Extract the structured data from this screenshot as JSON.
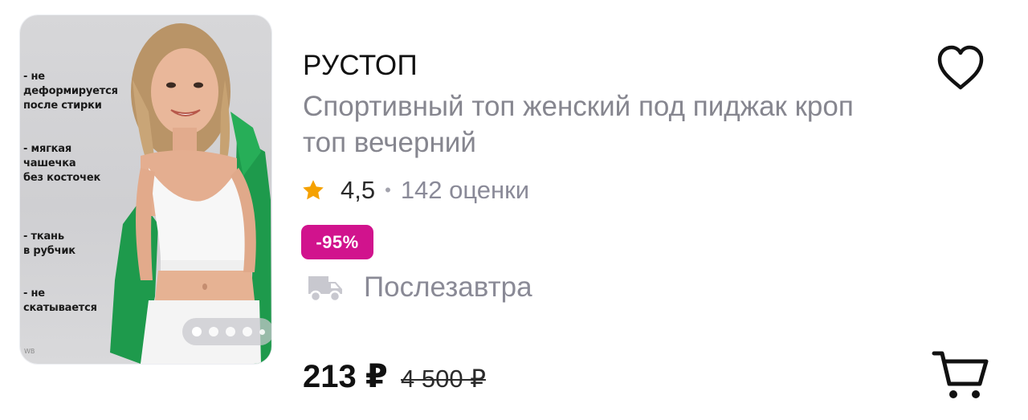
{
  "product": {
    "brand": "РУСТОП",
    "title": "Спортивный топ женский под пиджак кроп топ вечерний",
    "rating": "4,5",
    "separator": "•",
    "reviews": "142 оценки",
    "discount": "-95%",
    "delivery": "Послезавтра",
    "price": "213 ₽",
    "old_price": "4 500 ₽"
  },
  "image": {
    "features": [
      "- не\nдеформируется\nпосле стирки",
      "- мягкая\nчашечка\nбез косточек",
      "- ткань\nв рубчик",
      "- не\nскатывается"
    ],
    "watermark": "WB",
    "carousel_dots": 5,
    "carousel_active": 1
  },
  "icons": {
    "favorite": "heart-outline-icon",
    "cart": "shopping-cart-icon",
    "delivery": "truck-icon",
    "rating": "star-icon"
  },
  "colors": {
    "discount_badge": "#d1138d",
    "star": "#f5a100",
    "secondary_text": "#86868f"
  }
}
